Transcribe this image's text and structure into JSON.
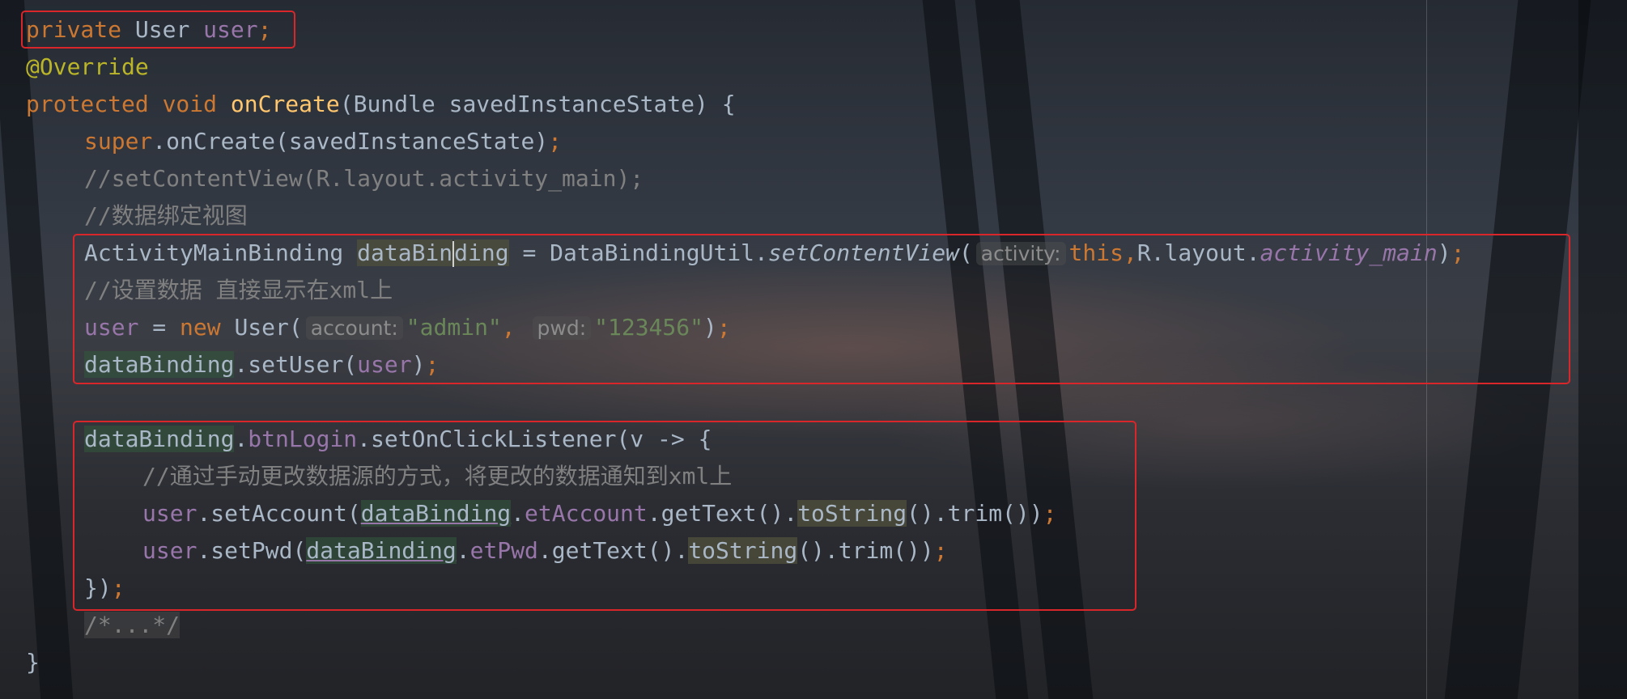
{
  "editor": {
    "lines": [
      {
        "tokens": [
          {
            "t": "private",
            "c": "kw"
          },
          {
            "t": " User "
          },
          {
            "t": "user",
            "c": "fld"
          },
          {
            "t": ";",
            "c": "kw"
          }
        ]
      },
      {
        "tokens": [
          {
            "t": "@Override",
            "c": "ann"
          }
        ]
      },
      {
        "tokens": [
          {
            "t": "protected",
            "c": "kw"
          },
          {
            "t": " "
          },
          {
            "t": "void",
            "c": "kw"
          },
          {
            "t": " "
          },
          {
            "t": "onCreate",
            "c": "fn"
          },
          {
            "t": "(Bundle savedInstanceState) {"
          }
        ]
      },
      {
        "indent": 1,
        "tokens": [
          {
            "t": "super",
            "c": "kw"
          },
          {
            "t": ".onCreate(savedInstanceState)"
          },
          {
            "t": ";",
            "c": "kw"
          }
        ]
      },
      {
        "indent": 1,
        "tokens": [
          {
            "t": "//setContentView(R.layout.activity_main);",
            "c": "cmt"
          }
        ]
      },
      {
        "indent": 1,
        "tokens": [
          {
            "t": "//数据绑定视图",
            "c": "cmt"
          }
        ]
      },
      {
        "indent": 1,
        "tokens": [
          {
            "t": "ActivityMainBinding "
          },
          {
            "t": "dataBin",
            "c": "hl2"
          },
          {
            "caret": true
          },
          {
            "t": "ding",
            "c": "hl2"
          },
          {
            "t": " = DataBindingUtil."
          },
          {
            "t": "setContentView",
            "c": "it"
          },
          {
            "t": "("
          },
          {
            "t": "activity:",
            "c": "hint"
          },
          {
            "t": "this",
            "c": "kw"
          },
          {
            "t": ",",
            "c": "kw"
          },
          {
            "t": "R.layout."
          },
          {
            "t": "activity_main",
            "c": "fld-i"
          },
          {
            "t": ")"
          },
          {
            "t": ";",
            "c": "kw"
          }
        ]
      },
      {
        "indent": 1,
        "tokens": [
          {
            "t": "//设置数据 直接显示在xml上",
            "c": "cmt"
          }
        ]
      },
      {
        "indent": 1,
        "tokens": [
          {
            "t": "user",
            "c": "fld"
          },
          {
            "t": " = "
          },
          {
            "t": "new",
            "c": "kw"
          },
          {
            "t": " User("
          },
          {
            "t": "account:",
            "c": "hint"
          },
          {
            "t": "\"admin\"",
            "c": "str"
          },
          {
            "t": ", ",
            "c": "kw"
          },
          {
            "t": "pwd:",
            "c": "hint"
          },
          {
            "t": "\"123456\"",
            "c": "str"
          },
          {
            "t": ")"
          },
          {
            "t": ";",
            "c": "kw"
          }
        ]
      },
      {
        "indent": 1,
        "tokens": [
          {
            "t": "dataBinding",
            "c": "hl"
          },
          {
            "t": ".setUser("
          },
          {
            "t": "user",
            "c": "fld"
          },
          {
            "t": ")"
          },
          {
            "t": ";",
            "c": "kw"
          }
        ]
      },
      {
        "tokens": []
      },
      {
        "indent": 1,
        "tokens": [
          {
            "t": "dataBinding",
            "c": "hl"
          },
          {
            "t": "."
          },
          {
            "t": "btnLogin",
            "c": "fld"
          },
          {
            "t": ".setOnClickListener(v -> {"
          }
        ]
      },
      {
        "indent": 2,
        "tokens": [
          {
            "t": "//通过手动更改数据源的方式，将更改的数据通知到xml上",
            "c": "cmt"
          }
        ]
      },
      {
        "indent": 2,
        "tokens": [
          {
            "t": "user",
            "c": "fld"
          },
          {
            "t": ".setAccount("
          },
          {
            "t": "dataBinding",
            "c": "ul hl"
          },
          {
            "t": "."
          },
          {
            "t": "etAccount",
            "c": "fld"
          },
          {
            "t": ".getText()."
          },
          {
            "t": "toString",
            "c": "hl2"
          },
          {
            "t": "().trim())"
          },
          {
            "t": ";",
            "c": "kw"
          }
        ]
      },
      {
        "indent": 2,
        "tokens": [
          {
            "t": "user",
            "c": "fld"
          },
          {
            "t": ".setPwd("
          },
          {
            "t": "dataBinding",
            "c": "ul hl"
          },
          {
            "t": "."
          },
          {
            "t": "etPwd",
            "c": "fld"
          },
          {
            "t": ".getText()."
          },
          {
            "t": "toString",
            "c": "hl2"
          },
          {
            "t": "().trim())"
          },
          {
            "t": ";",
            "c": "kw"
          }
        ]
      },
      {
        "indent": 1,
        "tokens": [
          {
            "t": "})"
          },
          {
            "t": ";",
            "c": "kw"
          }
        ]
      },
      {
        "indent": 1,
        "tokens": [
          {
            "t": "/*...*/",
            "c": "fold"
          }
        ]
      },
      {
        "tokens": [
          {
            "t": "}"
          }
        ]
      }
    ]
  }
}
